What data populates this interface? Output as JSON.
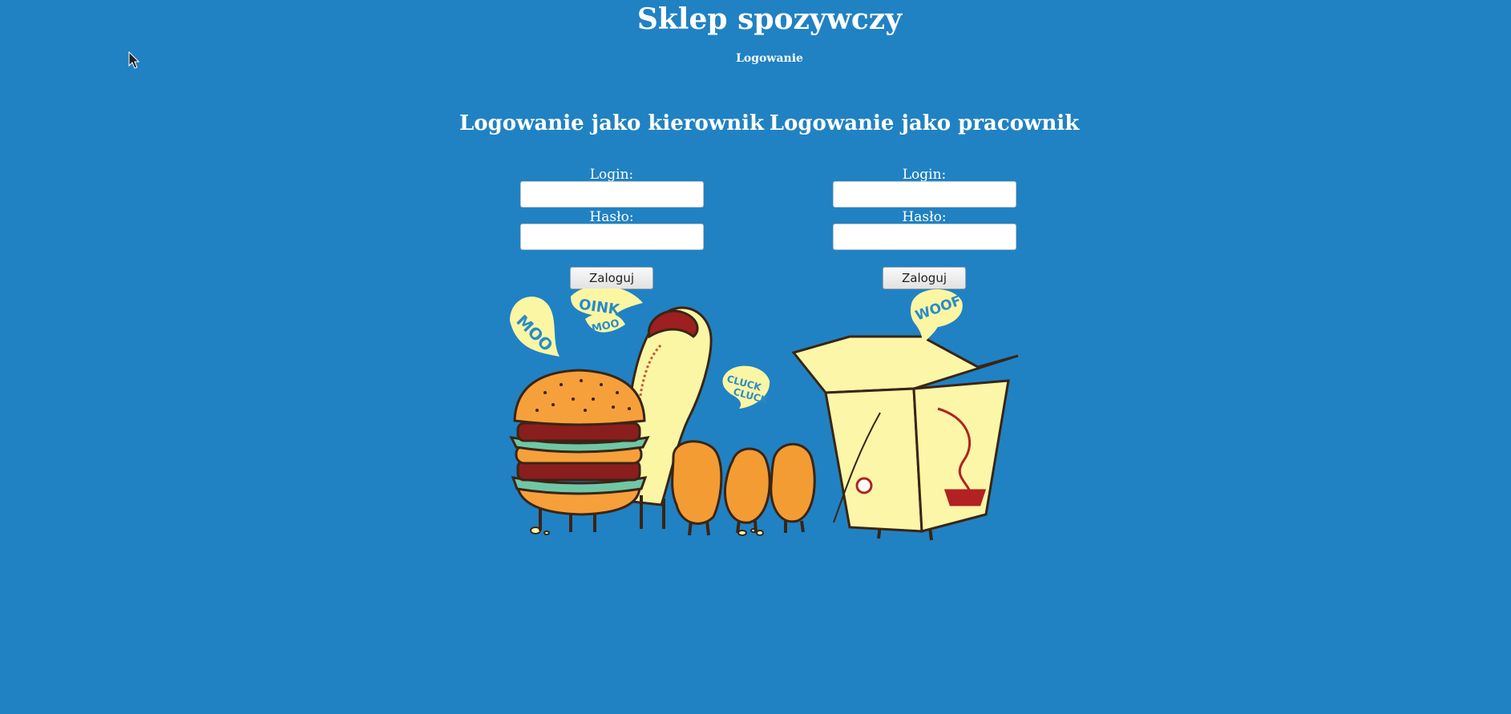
{
  "site": {
    "title": "Sklep spozywczy",
    "nav_link": "Logowanie"
  },
  "manager_login": {
    "heading": "Logowanie jako kierownik",
    "login_label": "Login:",
    "login_value": "",
    "password_label": "Hasło:",
    "password_value": "",
    "submit_label": "Zaloguj"
  },
  "worker_login": {
    "heading": "Logowanie jako pracownik",
    "login_label": "Login:",
    "login_value": "",
    "password_label": "Hasło:",
    "password_value": "",
    "submit_label": "Zaloguj"
  },
  "illustration": {
    "bubbles": {
      "moo_big": "MOO",
      "oink": "OINK",
      "moo_small": "MOO",
      "cluck1": "CLUCK",
      "cluck2": "CLUCK",
      "woof": "WOOF"
    }
  },
  "colors": {
    "background": "#2082c3",
    "bubble": "#fbf6a4",
    "bubble_text": "#2a8bc9",
    "bun": "#f5a03a",
    "lettuce": "#6fc7a6",
    "patty": "#8a1d1d",
    "nugget": "#f39c33",
    "box": "#fbf6a8",
    "outline": "#3a2415"
  }
}
